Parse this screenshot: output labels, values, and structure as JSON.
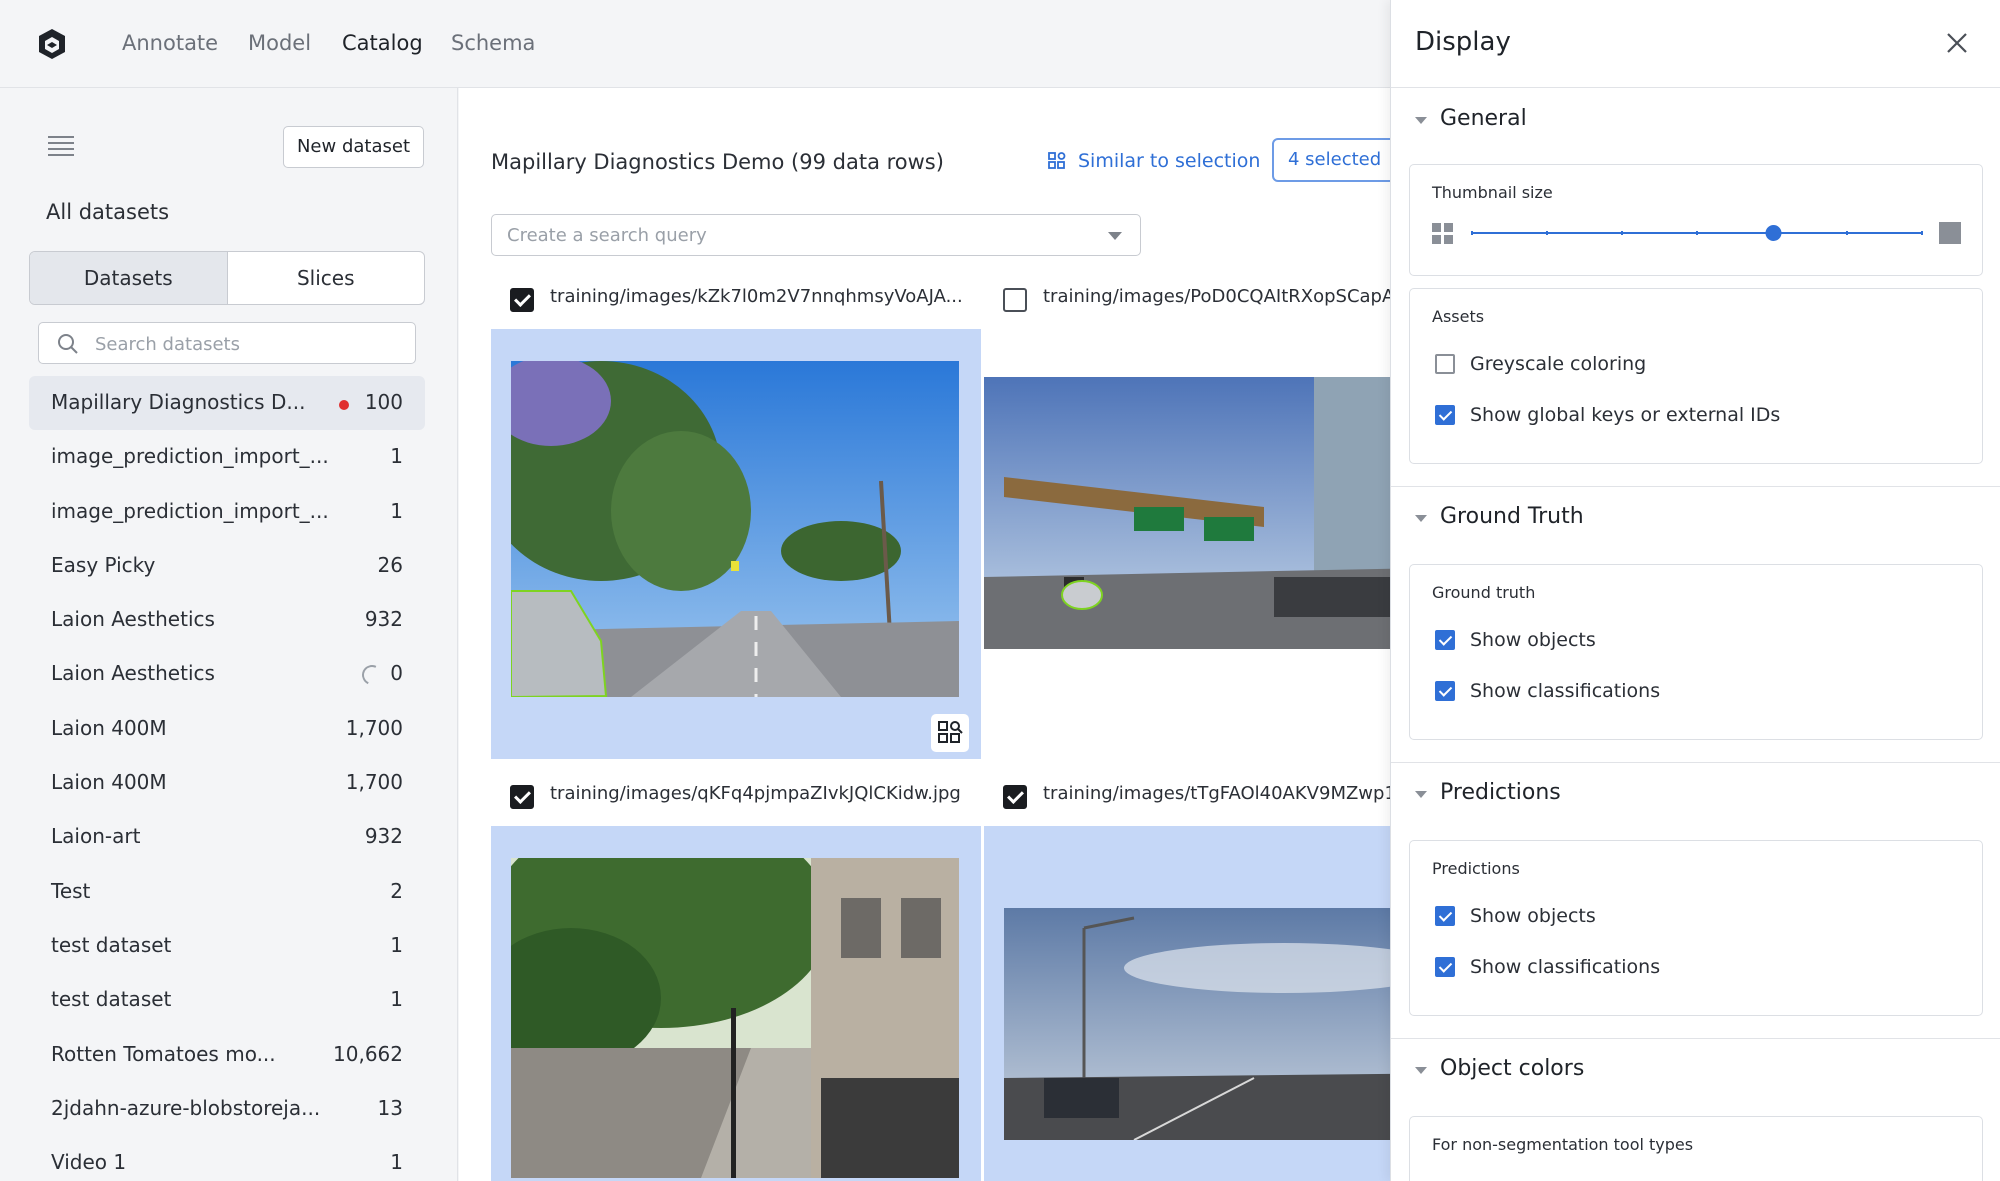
{
  "nav": {
    "items": [
      {
        "label": "Annotate"
      },
      {
        "label": "Model"
      },
      {
        "label": "Catalog"
      },
      {
        "label": "Schema"
      }
    ]
  },
  "sidebar": {
    "new_dataset_label": "New dataset",
    "all_datasets_label": "All datasets",
    "tabs": [
      {
        "label": "Datasets",
        "active": true
      },
      {
        "label": "Slices",
        "active": false
      }
    ],
    "search_placeholder": "Search datasets",
    "datasets": [
      {
        "name": "Mapillary Diagnostics D...",
        "count": "100",
        "active": true,
        "status": "red-dot"
      },
      {
        "name": "image_prediction_import_...",
        "count": "1"
      },
      {
        "name": "image_prediction_import_...",
        "count": "1"
      },
      {
        "name": "Easy Picky",
        "count": "26"
      },
      {
        "name": "Laion Aesthetics",
        "count": "932"
      },
      {
        "name": "Laion Aesthetics",
        "count": "0",
        "status": "loading"
      },
      {
        "name": "Laion 400M",
        "count": "1,700"
      },
      {
        "name": "Laion 400M",
        "count": "1,700"
      },
      {
        "name": "Laion-art",
        "count": "932"
      },
      {
        "name": "Test",
        "count": "2"
      },
      {
        "name": "test dataset",
        "count": "1"
      },
      {
        "name": "test dataset",
        "count": "1"
      },
      {
        "name": "Rotten Tomatoes mo...",
        "count": "10,662"
      },
      {
        "name": "2jdahn-azure-blobstoreja...",
        "count": "13"
      },
      {
        "name": "Video 1",
        "count": "1"
      }
    ]
  },
  "main": {
    "dataset_title": "Mapillary Diagnostics Demo",
    "row_count": "(99 data rows)",
    "similar_label": "Similar to selection",
    "selected_label": "4 selected",
    "query_placeholder": "Create a search query",
    "cards": [
      {
        "label": "training/images/kZk7l0m2V7nnqhmsyVoAJA...",
        "checked": true
      },
      {
        "label": "training/images/PoD0CQAItRXopSCapA",
        "checked": false
      },
      {
        "label": "training/images/qKFq4pjmpaZIvkJQlCKidw.jpg",
        "checked": true
      },
      {
        "label": "training/images/tTgFAOl40AKV9MZwp1",
        "checked": true
      }
    ]
  },
  "display": {
    "title": "Display",
    "sections": {
      "general": "General",
      "ground_truth": "Ground Truth",
      "predictions": "Predictions",
      "object_colors": "Object colors"
    },
    "thumbnail_size_label": "Thumbnail size",
    "thumbnail_size_value": 0.67,
    "assets_label": "Assets",
    "assets_options": [
      {
        "label": "Greyscale coloring",
        "checked": false
      },
      {
        "label": "Show global keys or external IDs",
        "checked": true
      }
    ],
    "ground_truth_label": "Ground truth",
    "ground_truth_options": [
      {
        "label": "Show objects",
        "checked": true
      },
      {
        "label": "Show classifications",
        "checked": true
      }
    ],
    "predictions_label": "Predictions",
    "predictions_options": [
      {
        "label": "Show objects",
        "checked": true
      },
      {
        "label": "Show classifications",
        "checked": true
      }
    ],
    "object_colors_label": "For non-segmentation tool types"
  },
  "colors": {
    "accent": "#2f6fd6",
    "selected_card": "#c5d7f7",
    "status_dot": "#e02f2f"
  }
}
